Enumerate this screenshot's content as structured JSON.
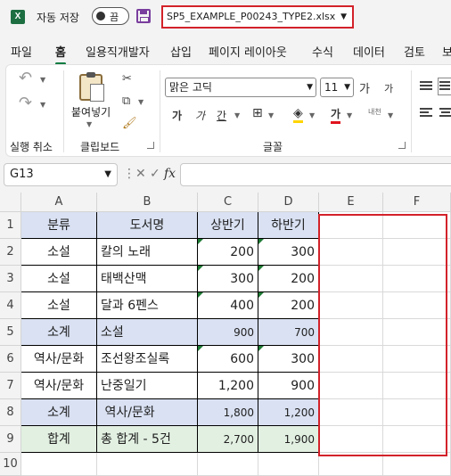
{
  "titlebar": {
    "app_icon": "X",
    "autosave_label": "자동 저장",
    "autosave_state": "끔",
    "filename": "SP5_EXAMPLE_P00243_TYPE2.xlsx"
  },
  "tabs": [
    "파일",
    "홈",
    "일용직개발자",
    "삽입",
    "페이지 레이아웃",
    "수식",
    "데이터",
    "검토",
    "보"
  ],
  "active_tab": "홈",
  "ribbon": {
    "undo_group": "실행 취소",
    "clipboard_group": "클립보드",
    "paste_label": "붙여넣기",
    "font_group": "글꼴",
    "font_name": "맑은 고딕",
    "font_size": "11",
    "grow_font": "가",
    "shrink_font": "가",
    "bold": "가",
    "italic": "가",
    "underline": "간",
    "font_color": "가",
    "phonetic": "내천"
  },
  "formula_bar": {
    "name_box": "G13",
    "cancel_icon": "✕",
    "enter_icon": "✓",
    "fx_label": "fx",
    "value": ""
  },
  "sheet": {
    "columns": [
      "A",
      "B",
      "C",
      "D",
      "E",
      "F"
    ],
    "rows": [
      "1",
      "2",
      "3",
      "4",
      "5",
      "6",
      "7",
      "8",
      "9",
      "10"
    ],
    "header": [
      "분류",
      "도서명",
      "상반기",
      "하반기"
    ],
    "data": [
      [
        "소설",
        "칼의 노래",
        "200",
        "300"
      ],
      [
        "소설",
        "태백산맥",
        "300",
        "200"
      ],
      [
        "소설",
        "달과 6펜스",
        "400",
        "200"
      ],
      [
        "소계",
        "소설",
        "900",
        "700"
      ],
      [
        "역사/문화",
        "조선왕조실록",
        "600",
        "300"
      ],
      [
        "역사/문화",
        "난중일기",
        "1,200",
        "900"
      ],
      [
        "소계",
        " 역사/문화",
        "1,800",
        "1,200"
      ],
      [
        "합계",
        "총 합계 - 5건",
        "2,700",
        "1,900"
      ]
    ]
  },
  "colors": {
    "header_fill": "#d9e1f2",
    "subtotal_fill": "#d9e1f2",
    "total_fill": "#e2f0e2",
    "highlight": "#d3222a",
    "accent": "#107c41"
  }
}
